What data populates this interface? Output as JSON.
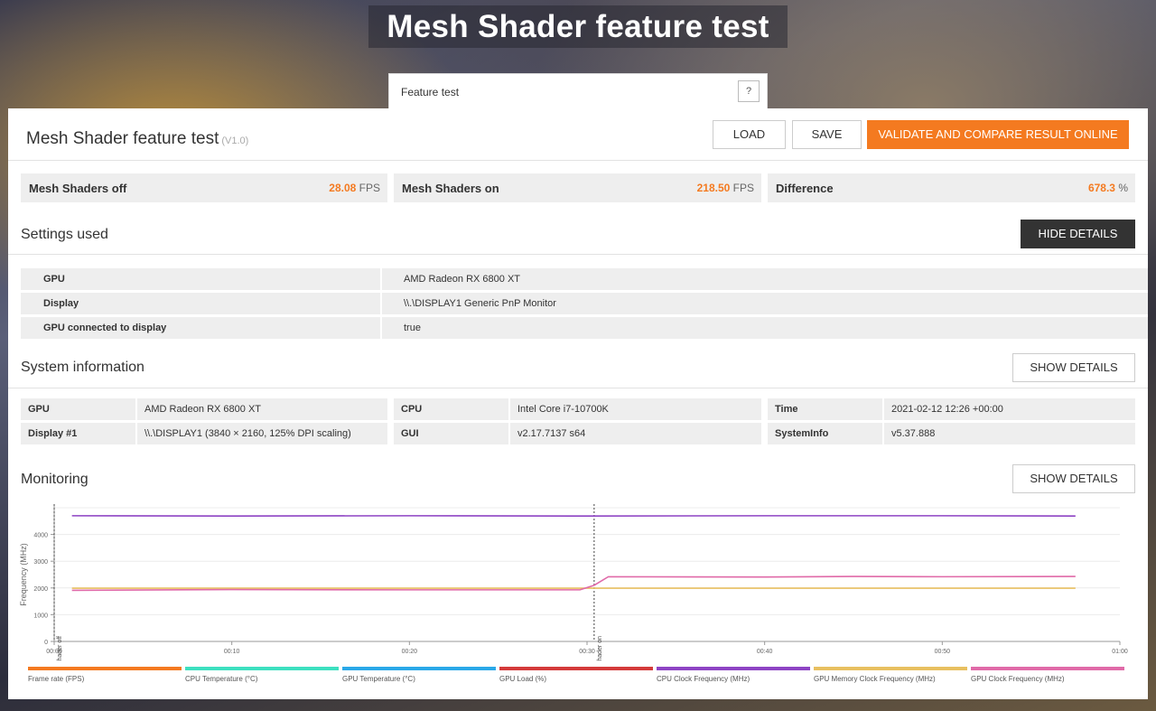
{
  "page": {
    "hero_title": "Mesh Shader feature test",
    "tab_label": "Feature test",
    "help_label": "?"
  },
  "header": {
    "title": "Mesh Shader feature test",
    "version": "(V1.0)",
    "load_label": "LOAD",
    "save_label": "SAVE",
    "validate_label": "VALIDATE AND COMPARE RESULT ONLINE"
  },
  "scores": [
    {
      "label": "Mesh Shaders off",
      "value": "28.08",
      "unit": "FPS"
    },
    {
      "label": "Mesh Shaders on",
      "value": "218.50",
      "unit": "FPS"
    },
    {
      "label": "Difference",
      "value": "678.3",
      "unit": "%"
    }
  ],
  "settings": {
    "title": "Settings used",
    "toggle_label": "HIDE DETAILS",
    "rows": [
      {
        "key": "GPU",
        "value": "AMD Radeon RX 6800 XT"
      },
      {
        "key": "Display",
        "value": "\\\\.\\DISPLAY1 Generic PnP Monitor"
      },
      {
        "key": "GPU connected to display",
        "value": "true"
      }
    ]
  },
  "system": {
    "title": "System information",
    "toggle_label": "SHOW DETAILS",
    "cells": [
      {
        "key": "GPU",
        "value": "AMD Radeon RX 6800 XT"
      },
      {
        "key": "CPU",
        "value": "Intel Core i7-10700K"
      },
      {
        "key": "Time",
        "value": "2021-02-12 12:26 +00:00"
      },
      {
        "key": "Display #1",
        "value": "\\\\.\\DISPLAY1 (3840 × 2160, 125% DPI scaling)"
      },
      {
        "key": "GUI",
        "value": "v2.17.7137 s64"
      },
      {
        "key": "SystemInfo",
        "value": "v5.37.888"
      }
    ]
  },
  "monitoring": {
    "title": "Monitoring",
    "toggle_label": "SHOW DETAILS"
  },
  "chart_data": {
    "type": "line",
    "ylabel": "Frequency (MHz)",
    "xlabel": "",
    "ylim": [
      0,
      5000
    ],
    "xlim": [
      0,
      60
    ],
    "yticks": [
      "0",
      "1000",
      "2000",
      "3000",
      "4000"
    ],
    "xticks": [
      "00:00",
      "00:10",
      "00:20",
      "00:30",
      "00:40",
      "00:50",
      "01:00"
    ],
    "grid": true,
    "markers": [
      {
        "label": "Mesh Shader off",
        "x": 0
      },
      {
        "label": "Mesh Shader on",
        "x": 30.4
      }
    ],
    "series": [
      {
        "name": "CPU Clock Frequency (MHz)",
        "color": "#8e44c4",
        "x": [
          1,
          10,
          20,
          30,
          40,
          50,
          57.5
        ],
        "values": [
          4700,
          4690,
          4700,
          4690,
          4700,
          4700,
          4690
        ]
      },
      {
        "name": "GPU Memory Clock Frequency (MHz)",
        "color": "#e8c060",
        "x": [
          1,
          10,
          20,
          30,
          40,
          50,
          57.5
        ],
        "values": [
          1990,
          1990,
          1990,
          1990,
          1990,
          1990,
          1990
        ]
      },
      {
        "name": "GPU Clock Frequency (MHz)",
        "color": "#e06aa8",
        "x": [
          1,
          10,
          20,
          29.6,
          30.4,
          31.2,
          40,
          45,
          50,
          57.5
        ],
        "values": [
          1910,
          1940,
          1930,
          1930,
          2100,
          2420,
          2410,
          2430,
          2420,
          2430
        ]
      }
    ],
    "legend": [
      {
        "name": "Frame rate (FPS)",
        "color": "#f47a20"
      },
      {
        "name": "CPU Temperature (°C)",
        "color": "#3de0c0"
      },
      {
        "name": "GPU Temperature (°C)",
        "color": "#2aa8e8"
      },
      {
        "name": "GPU Load (%)",
        "color": "#d43a3a"
      },
      {
        "name": "CPU Clock Frequency (MHz)",
        "color": "#8e44c4"
      },
      {
        "name": "GPU Memory Clock Frequency (MHz)",
        "color": "#e8c060"
      },
      {
        "name": "GPU Clock Frequency (MHz)",
        "color": "#e06aa8"
      }
    ]
  }
}
